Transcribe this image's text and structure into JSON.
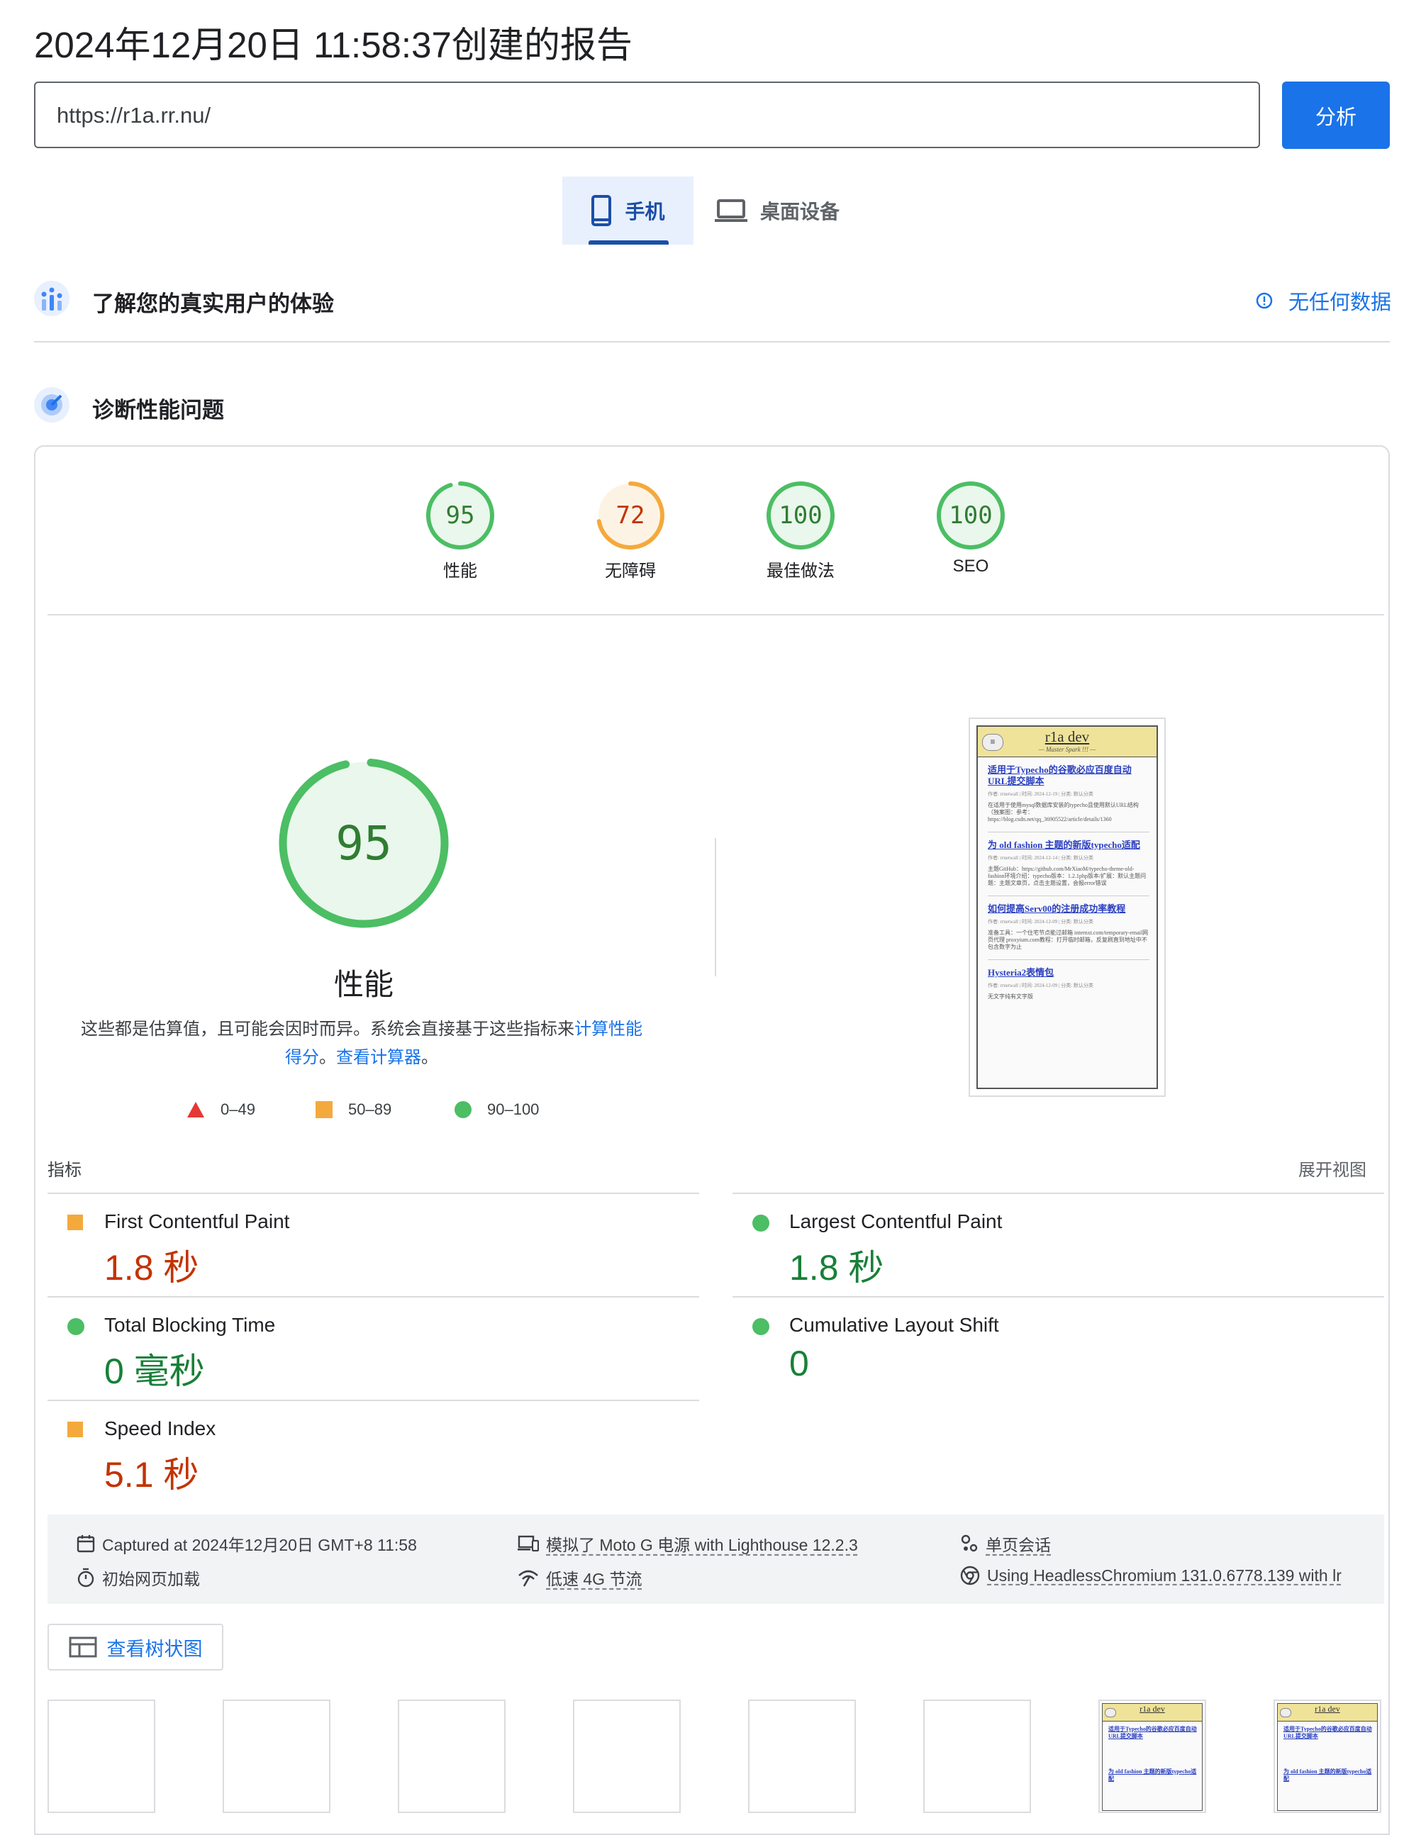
{
  "header": {
    "title": "2024年12月20日 11:58:37创建的报告",
    "url_value": "https://r1a.rr.nu/",
    "analyze_label": "分析"
  },
  "tabs": [
    {
      "label": "手机",
      "icon": "phone-icon",
      "selected": true
    },
    {
      "label": "桌面设备",
      "icon": "laptop-icon",
      "selected": false
    }
  ],
  "field_data": {
    "heading": "了解您的真实用户的体验",
    "status": "无任何数据"
  },
  "diagnose": {
    "heading": "诊断性能问题"
  },
  "categories": [
    {
      "score": "95",
      "label": "性能",
      "status": "pass"
    },
    {
      "score": "72",
      "label": "无障碍",
      "status": "average"
    },
    {
      "score": "100",
      "label": "最佳做法",
      "status": "pass"
    },
    {
      "score": "100",
      "label": "SEO",
      "status": "pass"
    }
  ],
  "performance": {
    "score": "95",
    "label": "性能",
    "desc_prefix": "这些都是估算值，且可能会因时而异。系统会直接基于这些指标来",
    "desc_link1": "计算性能得分",
    "desc_middle": "。",
    "desc_link2": "查看计算器",
    "desc_suffix": "。"
  },
  "legend": [
    {
      "shape": "triangle",
      "range": "0–49",
      "color": "#e53935"
    },
    {
      "shape": "square",
      "range": "50–89",
      "color": "#f4a93c"
    },
    {
      "shape": "circle",
      "range": "90–100",
      "color": "#4cbe64"
    }
  ],
  "screenshot": {
    "site_title": "r1a dev",
    "site_subtitle": "— Master Spark !!! —",
    "post1_title": "适用于Typecho的谷歌必应百度自动URL提交脚本",
    "post1_meta": "作者: rrnetwall | 时间: 2024-12-19 | 分类: 默认分类",
    "post1_text": "在适用于使用mysql数据库安装的typecho且使用默认URL结构（独案图：参考：https://blog.csdn.net/qq_36905522/article/details/1360",
    "post2_title": "为 old fashion 主题的新版typecho适配",
    "post2_meta": "作者: rrnetwall | 时间: 2024-12-14 | 分类: 默认分类",
    "post2_text": "主题GitHub：https://github.com/MrXiaoM/typecho-theme-old-fashion环境介绍：typecho版本：1.2.1php版本/扩展：默认主题问题：主题文章页，点击主题设置，会报error错误",
    "post3_title": "如何提高Serv00的注册成功率教程",
    "post3_meta": "作者: rrnetwall | 时间: 2024-12-09 | 分类: 默认分类",
    "post3_text": "准备工具：一个住宅节点能过邮箱 internxt.com/temporary-email网页代理 proxyium.com教程：打开临时邮箱，反复刷直到地址中不包含数字为止",
    "post4_title": "Hysteria2表情包",
    "post4_meta": "作者: rrnetwall | 时间: 2024-12-09 | 分类: 默认分类",
    "post4_text": "无文字纯有文字版"
  },
  "metrics": {
    "heading": "指标",
    "expand_label": "展开视图",
    "items": [
      {
        "name": "First Contentful Paint",
        "value": "1.8 秒",
        "status": "average"
      },
      {
        "name": "Largest Contentful Paint",
        "value": "1.8 秒",
        "status": "pass"
      },
      {
        "name": "Total Blocking Time",
        "value": "0 毫秒",
        "status": "pass"
      },
      {
        "name": "Cumulative Layout Shift",
        "value": "0",
        "status": "pass"
      },
      {
        "name": "Speed Index",
        "value": "5.1 秒",
        "status": "average"
      }
    ]
  },
  "environment": {
    "captured": "Captured at 2024年12月20日 GMT+8 11:58",
    "emulated": "模拟了 Moto G 电源 with Lighthouse 12.2.3",
    "session": "单页会话",
    "page_load": "初始网页加载",
    "throttling": "低速 4G 节流",
    "browser": "Using HeadlessChromium 131.0.6778.139 with lr"
  },
  "treemap_label": "查看树状图",
  "colors": {
    "accent": "#1a73e8",
    "pass": "#0cce6b",
    "average": "#ffa400",
    "fail": "#ff4e42"
  }
}
